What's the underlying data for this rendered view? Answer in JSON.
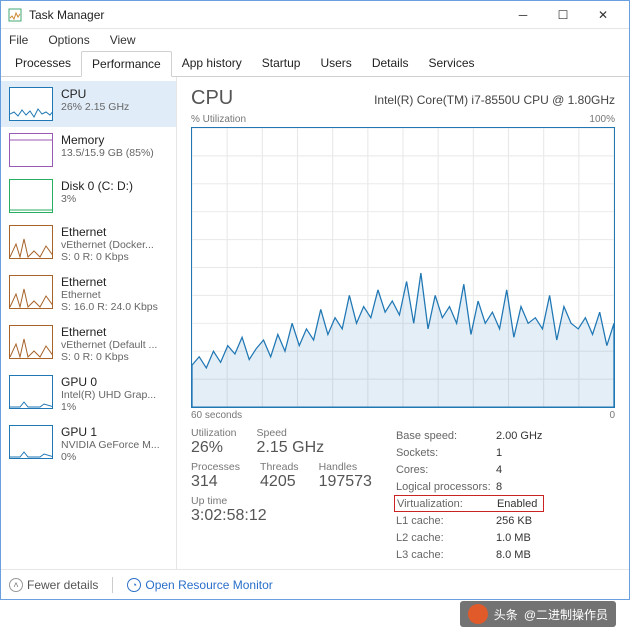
{
  "window": {
    "title": "Task Manager",
    "menus": [
      "File",
      "Options",
      "View"
    ],
    "tabs": [
      "Processes",
      "Performance",
      "App history",
      "Startup",
      "Users",
      "Details",
      "Services"
    ],
    "active_tab": "Performance"
  },
  "sidebar": {
    "items": [
      {
        "name": "CPU",
        "sub1": "26%  2.15 GHz",
        "sub2": "",
        "type": "cpu"
      },
      {
        "name": "Memory",
        "sub1": "13.5/15.9 GB (85%)",
        "sub2": "",
        "type": "mem"
      },
      {
        "name": "Disk 0 (C: D:)",
        "sub1": "3%",
        "sub2": "",
        "type": "disk"
      },
      {
        "name": "Ethernet",
        "sub1": "vEthernet (Docker...",
        "sub2": "S: 0  R: 0 Kbps",
        "type": "net"
      },
      {
        "name": "Ethernet",
        "sub1": "Ethernet",
        "sub2": "S: 16.0  R: 24.0 Kbps",
        "type": "net"
      },
      {
        "name": "Ethernet",
        "sub1": "vEthernet (Default ...",
        "sub2": "S: 0  R: 0 Kbps",
        "type": "net"
      },
      {
        "name": "GPU 0",
        "sub1": "Intel(R) UHD Grap...",
        "sub2": "1%",
        "type": "gpu"
      },
      {
        "name": "GPU 1",
        "sub1": "NVIDIA GeForce M...",
        "sub2": "0%",
        "type": "gpu"
      }
    ]
  },
  "main": {
    "title": "CPU",
    "model": "Intel(R) Core(TM) i7-8550U CPU @ 1.80GHz",
    "chart_top_left": "% Utilization",
    "chart_top_right": "100%",
    "chart_bot_left": "60 seconds",
    "chart_bot_right": "0",
    "stats_left": {
      "utilization_lbl": "Utilization",
      "utilization_val": "26%",
      "speed_lbl": "Speed",
      "speed_val": "2.15 GHz",
      "processes_lbl": "Processes",
      "processes_val": "314",
      "threads_lbl": "Threads",
      "threads_val": "4205",
      "handles_lbl": "Handles",
      "handles_val": "197573",
      "uptime_lbl": "Up time",
      "uptime_val": "3:02:58:12"
    },
    "stats_right": [
      {
        "k": "Base speed:",
        "v": "2.00 GHz"
      },
      {
        "k": "Sockets:",
        "v": "1"
      },
      {
        "k": "Cores:",
        "v": "4"
      },
      {
        "k": "Logical processors:",
        "v": "8"
      },
      {
        "k": "Virtualization:",
        "v": "Enabled",
        "hl": true
      },
      {
        "k": "L1 cache:",
        "v": "256 KB"
      },
      {
        "k": "L2 cache:",
        "v": "1.0 MB"
      },
      {
        "k": "L3 cache:",
        "v": "8.0 MB"
      }
    ]
  },
  "footer": {
    "fewer": "Fewer details",
    "orm": "Open Resource Monitor"
  },
  "watermark": {
    "prefix": "头条",
    "name": "@二进制操作员"
  },
  "chart_data": {
    "type": "line",
    "title": "% Utilization",
    "xlabel": "60 seconds",
    "ylabel": "",
    "ylim": [
      0,
      100
    ],
    "values": [
      15,
      18,
      14,
      20,
      16,
      22,
      19,
      25,
      17,
      21,
      24,
      18,
      26,
      20,
      30,
      22,
      28,
      24,
      35,
      26,
      32,
      28,
      40,
      30,
      36,
      32,
      42,
      34,
      38,
      33,
      45,
      30,
      48,
      28,
      40,
      32,
      36,
      30,
      44,
      26,
      38,
      30,
      34,
      28,
      42,
      25,
      36,
      30,
      32,
      28,
      40,
      24,
      36,
      30,
      28,
      32,
      26,
      34,
      22,
      30
    ]
  }
}
